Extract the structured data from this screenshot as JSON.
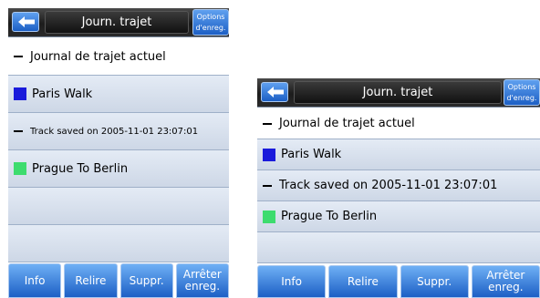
{
  "screens": [
    {
      "title": "Journ. trajet",
      "options_line1": "Options",
      "options_line2": "d'enreg.",
      "rows": [
        {
          "label": "Journal de trajet actuel",
          "marker": "dash",
          "color": null
        },
        {
          "label": "Paris Walk",
          "marker": "swatch",
          "color": "#1a1adb"
        },
        {
          "label": "Track saved on 2005-11-01 23:07:01",
          "marker": "dash",
          "color": null
        },
        {
          "label": "Prague To Berlin",
          "marker": "swatch",
          "color": "#3ddc6e"
        },
        {
          "label": "",
          "marker": "none",
          "color": null
        },
        {
          "label": "",
          "marker": "none",
          "color": null
        }
      ],
      "buttons": {
        "info": "Info",
        "relire": "Relire",
        "suppr": "Suppr.",
        "arreter_line1": "Arrêter",
        "arreter_line2": "enreg."
      }
    },
    {
      "title": "Journ. trajet",
      "options_line1": "Options",
      "options_line2": "d'enreg.",
      "rows": [
        {
          "label": "Journal de trajet actuel",
          "marker": "dash",
          "color": null
        },
        {
          "label": "Paris Walk",
          "marker": "swatch",
          "color": "#1a1adb"
        },
        {
          "label": "Track saved on 2005-11-01 23:07:01",
          "marker": "dash",
          "color": null
        },
        {
          "label": "Prague To Berlin",
          "marker": "swatch",
          "color": "#3ddc6e"
        },
        {
          "label": "",
          "marker": "none",
          "color": null
        }
      ],
      "buttons": {
        "info": "Info",
        "relire": "Relire",
        "suppr": "Suppr.",
        "arreter_line1": "Arrêter",
        "arreter_line2": "enreg."
      }
    }
  ],
  "icons": {
    "back": "back-arrow-icon"
  },
  "colors": {
    "accent": "#1c5fc5",
    "row_bg": "#dbe3ef",
    "topbar": "#1c1c1c"
  }
}
